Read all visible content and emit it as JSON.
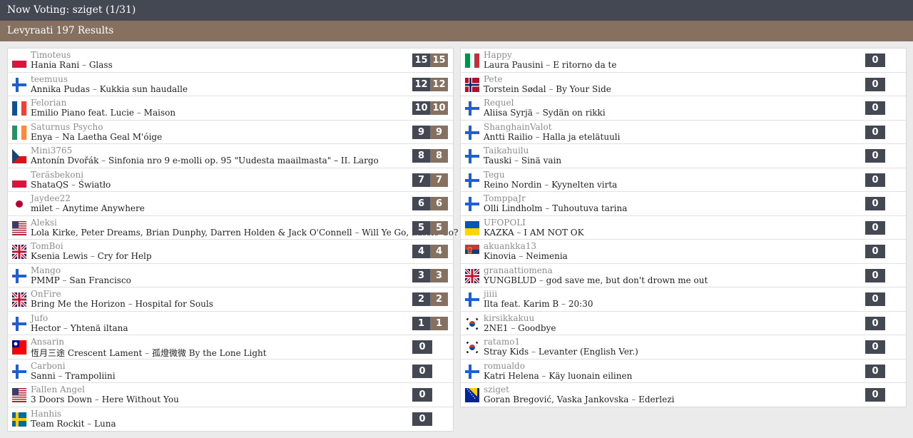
{
  "header": {
    "now_voting": "Now Voting: sziget (1/31)"
  },
  "results_bar": {
    "title": "Levyraati 197 Results"
  },
  "colors": {
    "dark": "#434852",
    "brown": "#86705f"
  },
  "left_entries": [
    {
      "flag": "poland",
      "voter": "Timoteus",
      "artist": "Hania Rani",
      "title": "Glass",
      "points": "15",
      "total": "15"
    },
    {
      "flag": "finland",
      "voter": "teemuus",
      "artist": "Annika Pudas",
      "title": "Kukkia sun haudalle",
      "points": "12",
      "total": "12"
    },
    {
      "flag": "france",
      "voter": "Felorian",
      "artist": "Emilio Piano feat. Lucie",
      "title": "Maison",
      "points": "10",
      "total": "10"
    },
    {
      "flag": "ireland",
      "voter": "Saturnus Psycho",
      "artist": "Enya",
      "title": "Na Laetha Geal M'óige",
      "points": "9",
      "total": "9"
    },
    {
      "flag": "czechia",
      "voter": "Mini3765",
      "artist": "Antonín Dvořák",
      "title": "Sinfonia nro 9 e-molli op. 95 \"Uudesta maailmasta\" – II. Largo",
      "points": "8",
      "total": "8"
    },
    {
      "flag": "poland",
      "voter": "Teräsbekoni",
      "artist": "ShataQS",
      "title": "Światło",
      "points": "7",
      "total": "7"
    },
    {
      "flag": "japan",
      "voter": "Jaydee22",
      "artist": "milet",
      "title": "Anytime Anywhere",
      "points": "6",
      "total": "6"
    },
    {
      "flag": "usa",
      "voter": "Aleksi",
      "artist": "Lola Kirke, Peter Dreams, Brian Dunphy, Darren Holden & Jack O'Connell",
      "title": "Will Ye Go, Lassie Go?",
      "points": "5",
      "total": "5"
    },
    {
      "flag": "uk",
      "voter": "TomBoi",
      "artist": "Ksenia Lewis",
      "title": "Cry for Help",
      "points": "4",
      "total": "4"
    },
    {
      "flag": "finland",
      "voter": "Mango",
      "artist": "PMMP",
      "title": "San Francisco",
      "points": "3",
      "total": "3"
    },
    {
      "flag": "uk",
      "voter": "OnFire",
      "artist": "Bring Me the Horizon",
      "title": "Hospital for Souls",
      "points": "2",
      "total": "2"
    },
    {
      "flag": "finland",
      "voter": "Jufo",
      "artist": "Hector",
      "title": "Yhtenä iltana",
      "points": "1",
      "total": "1"
    },
    {
      "flag": "taiwan",
      "voter": "Ansarin",
      "artist": "恆月三途 Crescent Lament",
      "title": "孤燈微微 By the Lone Light",
      "points": "0",
      "total": ""
    },
    {
      "flag": "finland",
      "voter": "Carboni",
      "artist": "Sanni",
      "title": "Trampoliini",
      "points": "0",
      "total": ""
    },
    {
      "flag": "usa",
      "voter": "Fallen Angel",
      "artist": "3 Doors Down",
      "title": "Here Without You",
      "points": "0",
      "total": ""
    },
    {
      "flag": "sweden",
      "voter": "Hanhis",
      "artist": "Team Rockit",
      "title": "Luna",
      "points": "0",
      "total": ""
    }
  ],
  "right_entries": [
    {
      "flag": "italy",
      "voter": "Happy",
      "artist": "Laura Pausini",
      "title": "E ritorno da te",
      "points": "0"
    },
    {
      "flag": "norway",
      "voter": "Pete",
      "artist": "Torstein Sødal",
      "title": "By Your Side",
      "points": "0"
    },
    {
      "flag": "finland",
      "voter": "Requel",
      "artist": "Aliisa Syrjä",
      "title": "Sydän on rikki",
      "points": "0"
    },
    {
      "flag": "finland",
      "voter": "ShanghainValot",
      "artist": "Antti Railio",
      "title": "Halla ja etelätuuli",
      "points": "0"
    },
    {
      "flag": "finland",
      "voter": "Taikahuilu",
      "artist": "Tauski",
      "title": "Sinä vain",
      "points": "0"
    },
    {
      "flag": "finland",
      "voter": "Tegu",
      "artist": "Reino Nordin",
      "title": "Kyynelten virta",
      "points": "0"
    },
    {
      "flag": "finland",
      "voter": "TomppaJr",
      "artist": "Olli Lindholm",
      "title": "Tuhoutuva tarina",
      "points": "0"
    },
    {
      "flag": "ukraine",
      "voter": "UFOPOLI",
      "artist": "KAZKA",
      "title": "I AM NOT OK",
      "points": "0"
    },
    {
      "flag": "serbia",
      "voter": "akuankka13",
      "artist": "Kinovia",
      "title": "Neimenia",
      "points": "0"
    },
    {
      "flag": "uk",
      "voter": "granaattiomena",
      "artist": "YUNGBLUD",
      "title": "god save me, but don't drown me out",
      "points": "0"
    },
    {
      "flag": "finland",
      "voter": "jiiii",
      "artist": "Ilta feat. Karim B",
      "title": "20:30",
      "points": "0"
    },
    {
      "flag": "south-korea",
      "voter": "kirsikkakuu",
      "artist": "2NE1",
      "title": "Goodbye",
      "points": "0"
    },
    {
      "flag": "south-korea",
      "voter": "ratamo1",
      "artist": "Stray Kids",
      "title": "Levanter (English Ver.)",
      "points": "0"
    },
    {
      "flag": "finland",
      "voter": "romualdo",
      "artist": "Katri Helena",
      "title": "Käy luonain eilinen",
      "points": "0"
    },
    {
      "flag": "bosnia",
      "voter": "sziget",
      "artist": "Goran Bregović, Vaska Jankovska",
      "title": "Ederlezi",
      "points": "0"
    }
  ]
}
